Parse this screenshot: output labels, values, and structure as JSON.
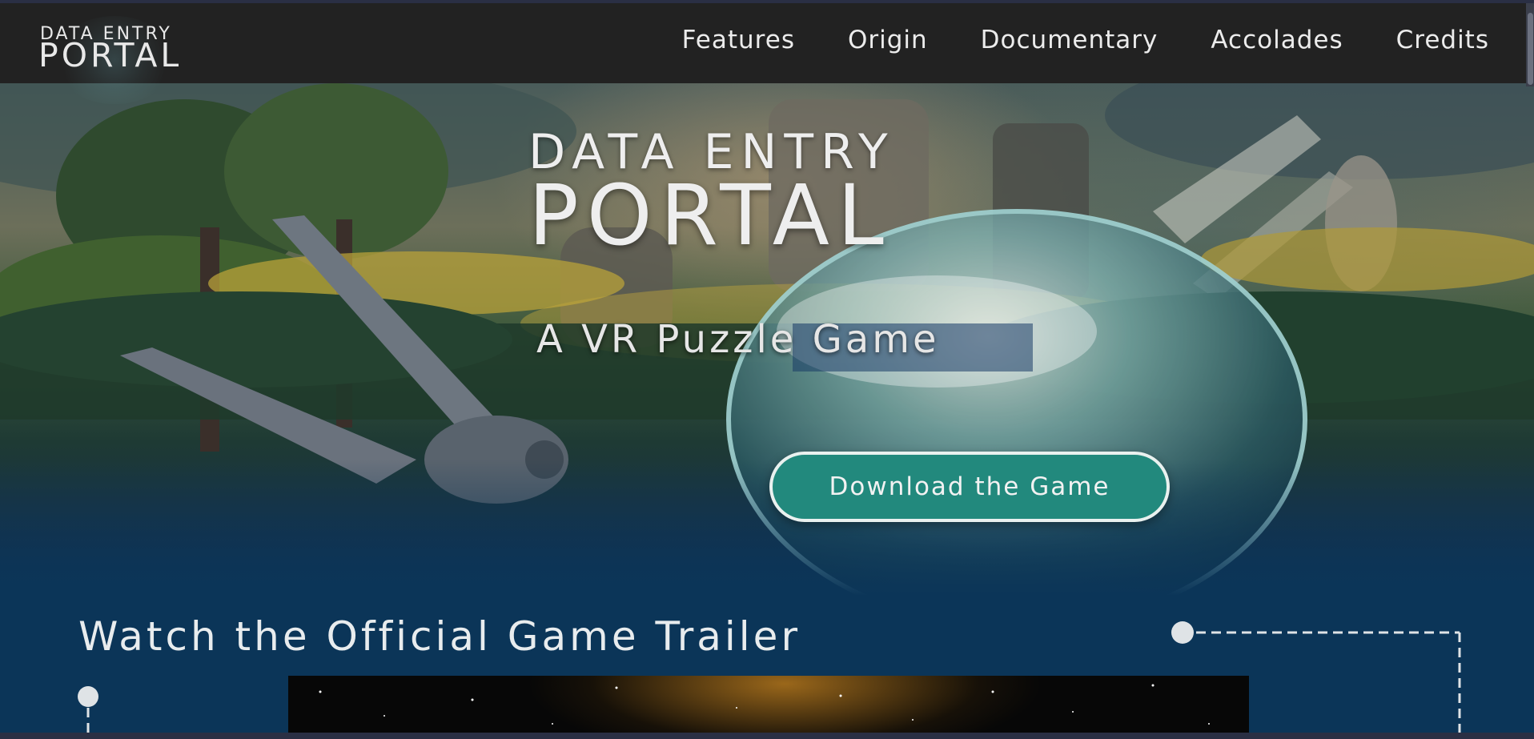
{
  "nav": {
    "logo_line1": "DATA ENTRY",
    "logo_line2": "PORTAL",
    "links": [
      "Features",
      "Origin",
      "Documentary",
      "Accolades",
      "Credits"
    ]
  },
  "hero": {
    "title_line1": "DATA ENTRY",
    "title_line2": "PORTAL",
    "subtitle": "A VR Puzzle Game",
    "download_label": "Download the Game"
  },
  "trailer": {
    "heading": "Watch the Official Game Trailer"
  },
  "colors": {
    "nav_background": "#222222",
    "section_background": "#0b3558",
    "button_fill": "#22897d",
    "button_border": "#e9f1ef",
    "text": "#eeeeee"
  },
  "icons": {
    "play_area": "video-icon",
    "timeline_node": "circle-dot-icon"
  }
}
